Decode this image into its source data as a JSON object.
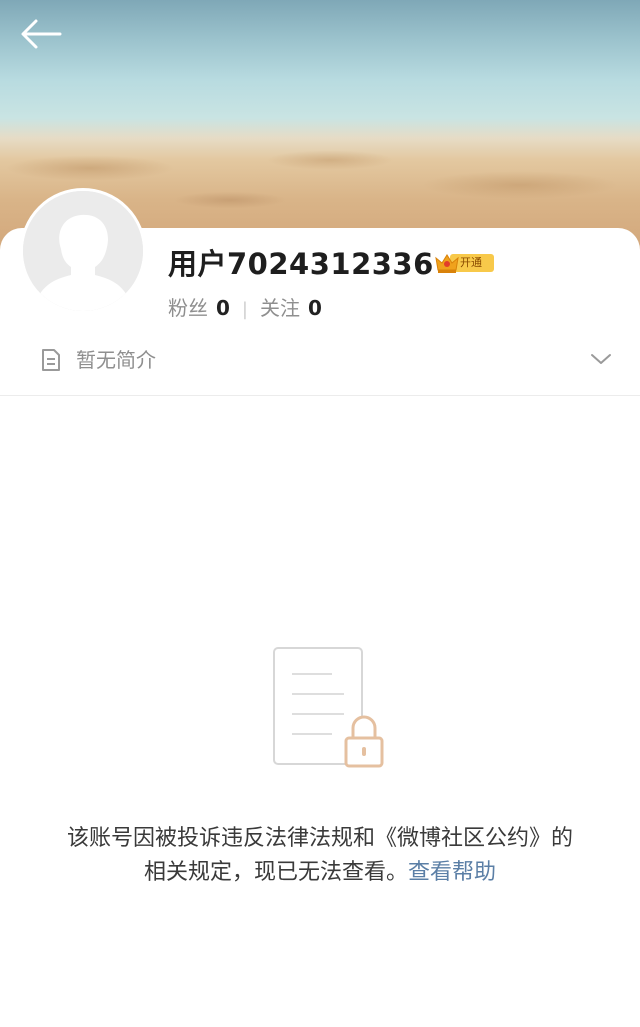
{
  "header": {
    "back_icon": "back-arrow-icon"
  },
  "profile": {
    "username": "用户7024312336",
    "vip_badge_label": "开通",
    "followers_label": "粉丝",
    "followers_count": "0",
    "separator": "|",
    "following_label": "关注",
    "following_count": "0",
    "bio": "暂无简介"
  },
  "notice": {
    "text": "该账号因被投诉违反法律法规和《微博社区公约》的相关规定，现已无法查看。",
    "help_link": "查看帮助"
  },
  "colors": {
    "link": "#5b7fa6",
    "lock_accent": "#e5c0a0",
    "badge_gold": "#f5b82e"
  }
}
